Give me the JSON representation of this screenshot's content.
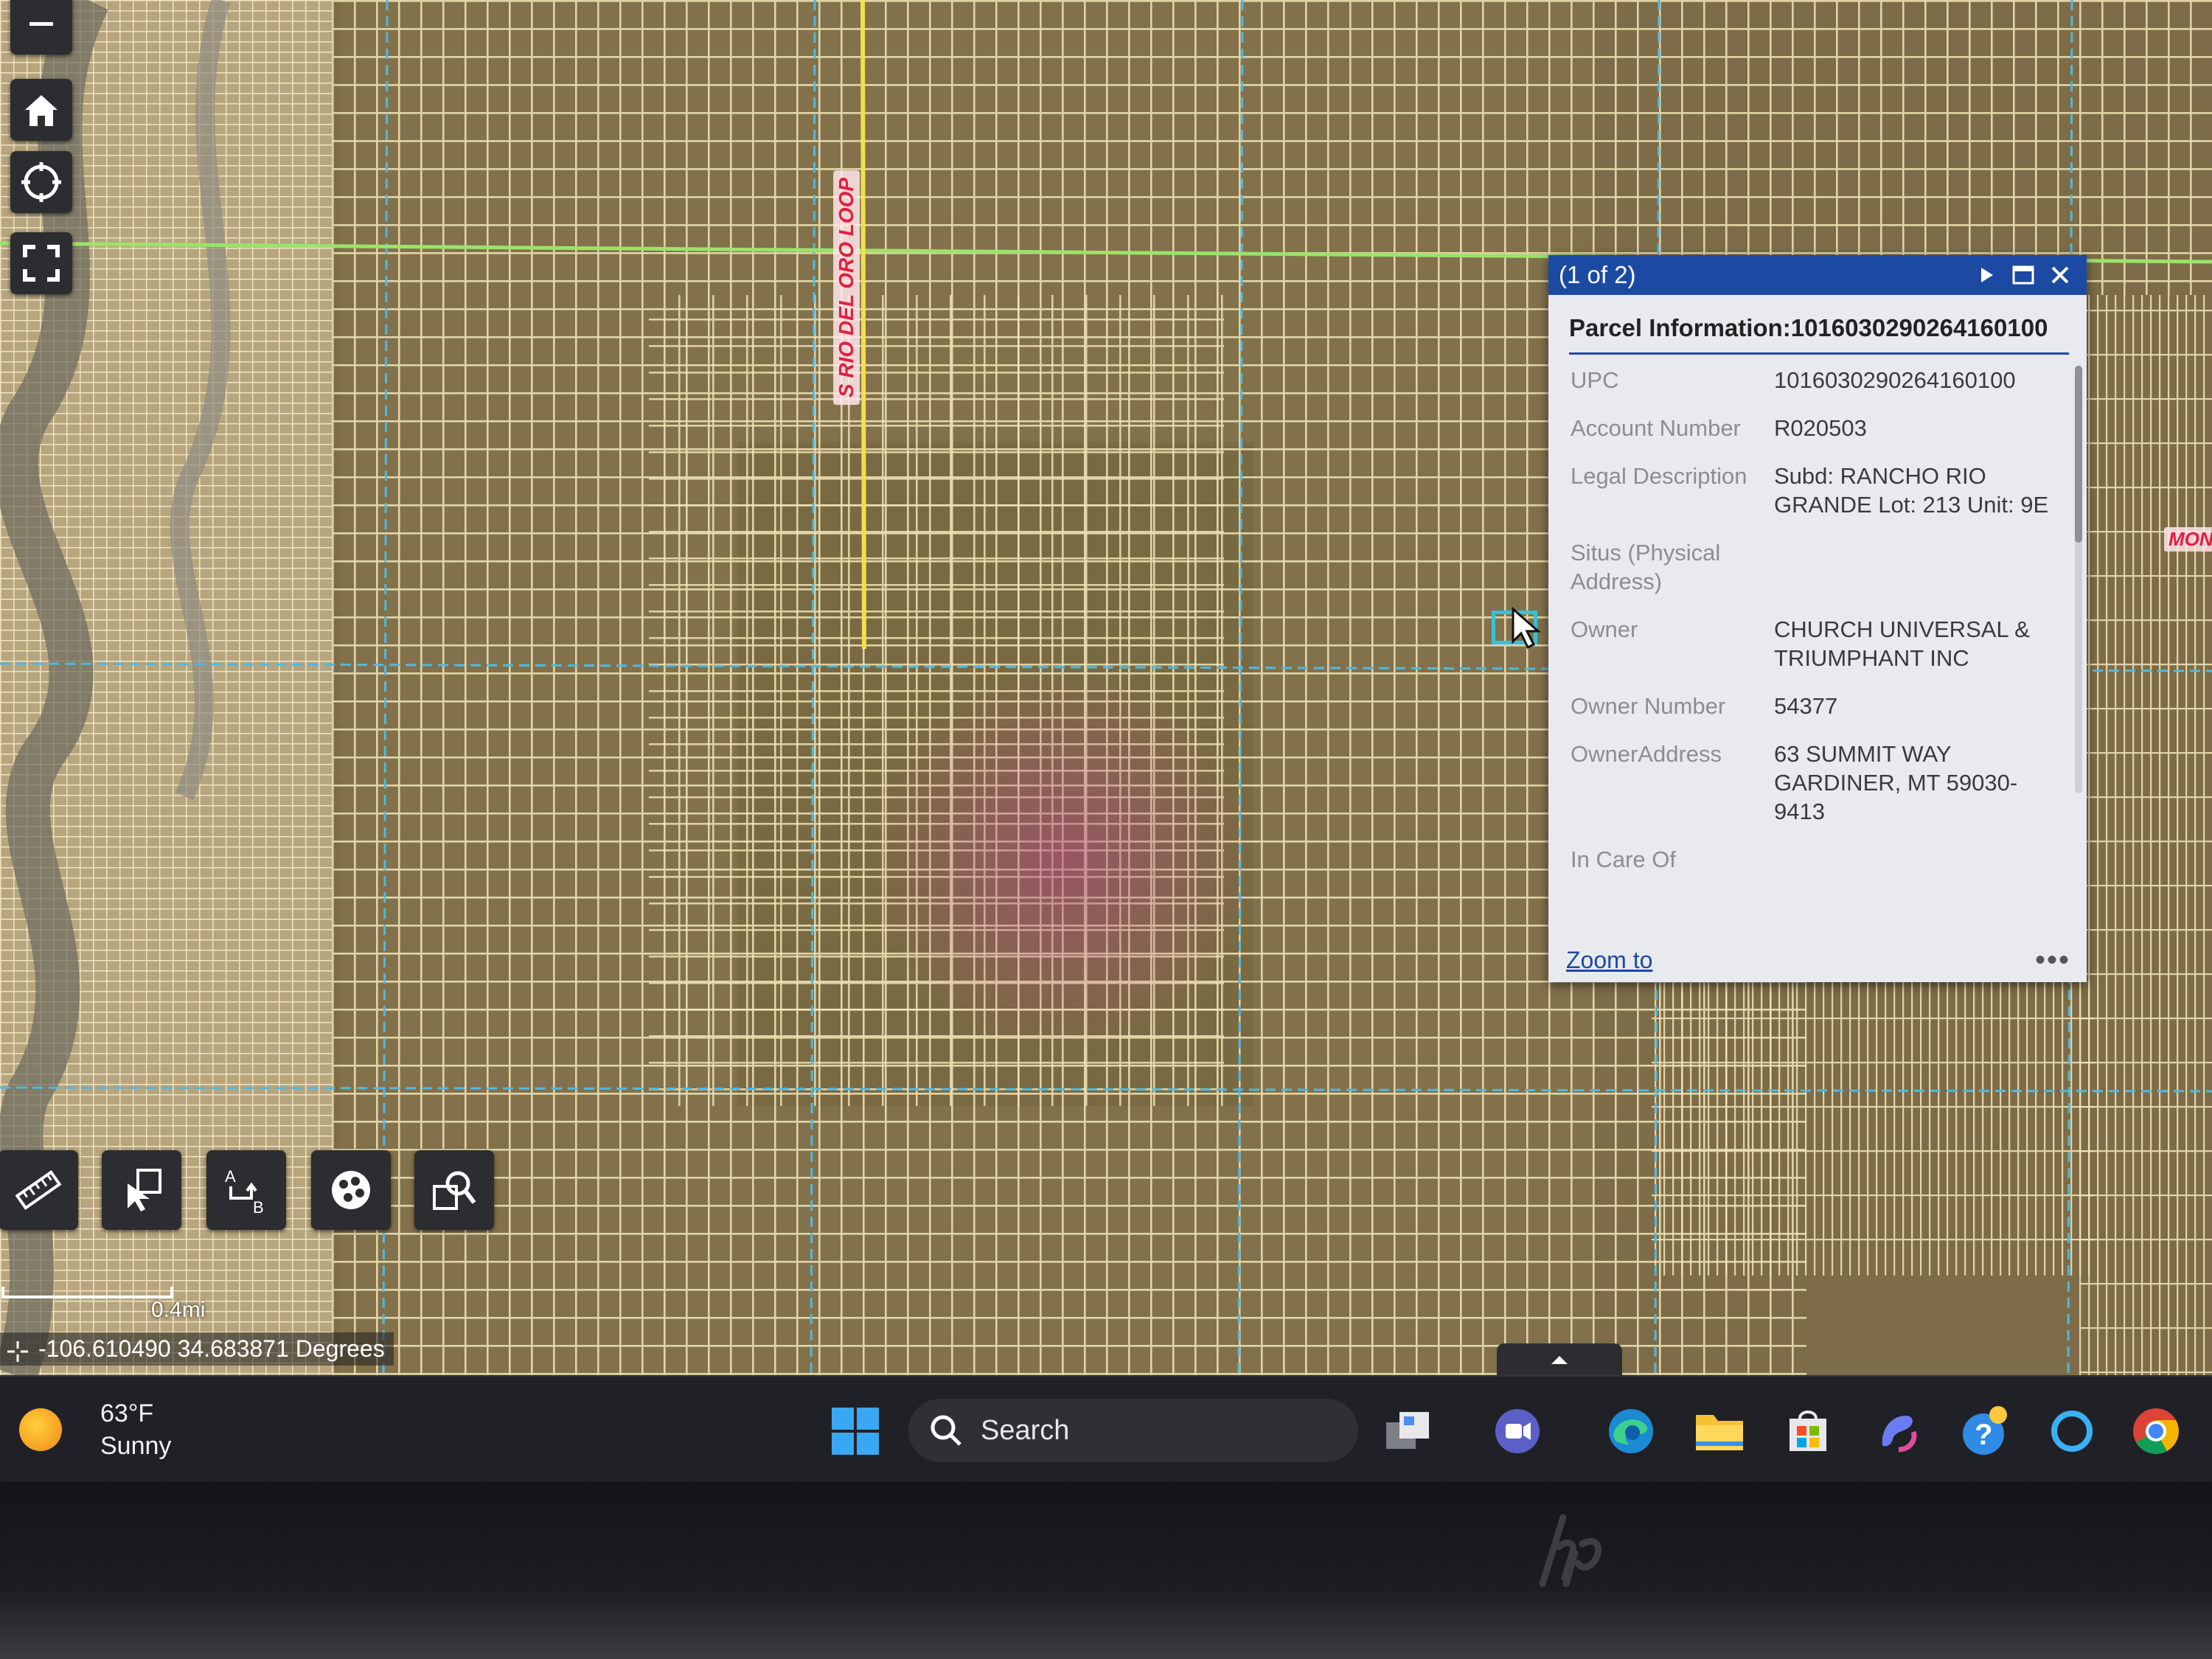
{
  "map": {
    "road_label": "S RIO DEL ORO LOOP",
    "edge_label": "MON",
    "scale_label": "0.4mi",
    "coordinates": "-106.610490 34.683871 Degrees"
  },
  "nav_buttons": [
    {
      "name": "zoom-out",
      "icon": "minus-icon"
    },
    {
      "name": "home",
      "icon": "home-icon"
    },
    {
      "name": "locate",
      "icon": "locate-icon"
    },
    {
      "name": "fullscreen",
      "icon": "fullscreen-icon"
    }
  ],
  "tools": [
    {
      "name": "measure",
      "icon": "ruler-icon"
    },
    {
      "name": "select",
      "icon": "select-icon"
    },
    {
      "name": "directions",
      "icon": "directions-icon"
    },
    {
      "name": "layers",
      "icon": "layers-icon"
    },
    {
      "name": "search-parcels",
      "icon": "search-map-icon"
    }
  ],
  "popup": {
    "count": "(1 of 2)",
    "title": "Parcel Information:1016030290264160100",
    "fields": [
      {
        "label": "UPC",
        "value": "1016030290264160100"
      },
      {
        "label": "Account Number",
        "value": "R020503"
      },
      {
        "label": "Legal Description",
        "value": "Subd: RANCHO RIO GRANDE Lot: 213 Unit: 9E"
      },
      {
        "label": "Situs (Physical Address)",
        "value": ""
      },
      {
        "label": "Owner",
        "value": "CHURCH UNIVERSAL & TRIUMPHANT INC"
      },
      {
        "label": "Owner Number",
        "value": "54377"
      },
      {
        "label": "OwnerAddress",
        "value": "63 SUMMIT WAY GARDINER, MT 59030-9413"
      },
      {
        "label": "In Care Of",
        "value": ""
      }
    ],
    "zoom_to": "Zoom to",
    "more": "•••"
  },
  "taskbar": {
    "temperature": "63°F",
    "condition": "Sunny",
    "search_placeholder": "Search",
    "apps": [
      "windows-start-icon",
      "task-view-icon",
      "teams-icon",
      "edge-icon",
      "file-explorer-icon",
      "store-icon",
      "copilot-icon",
      "help-icon",
      "cortana-icon",
      "chrome-icon"
    ]
  },
  "colors": {
    "popup_header": "#1c4aa3",
    "parcel_lines": "#f3e6b8",
    "road": "#f2e04a",
    "boundary": "#9be36a",
    "grid_dashed": "#4fb9e0",
    "road_label": "#e0203f"
  }
}
